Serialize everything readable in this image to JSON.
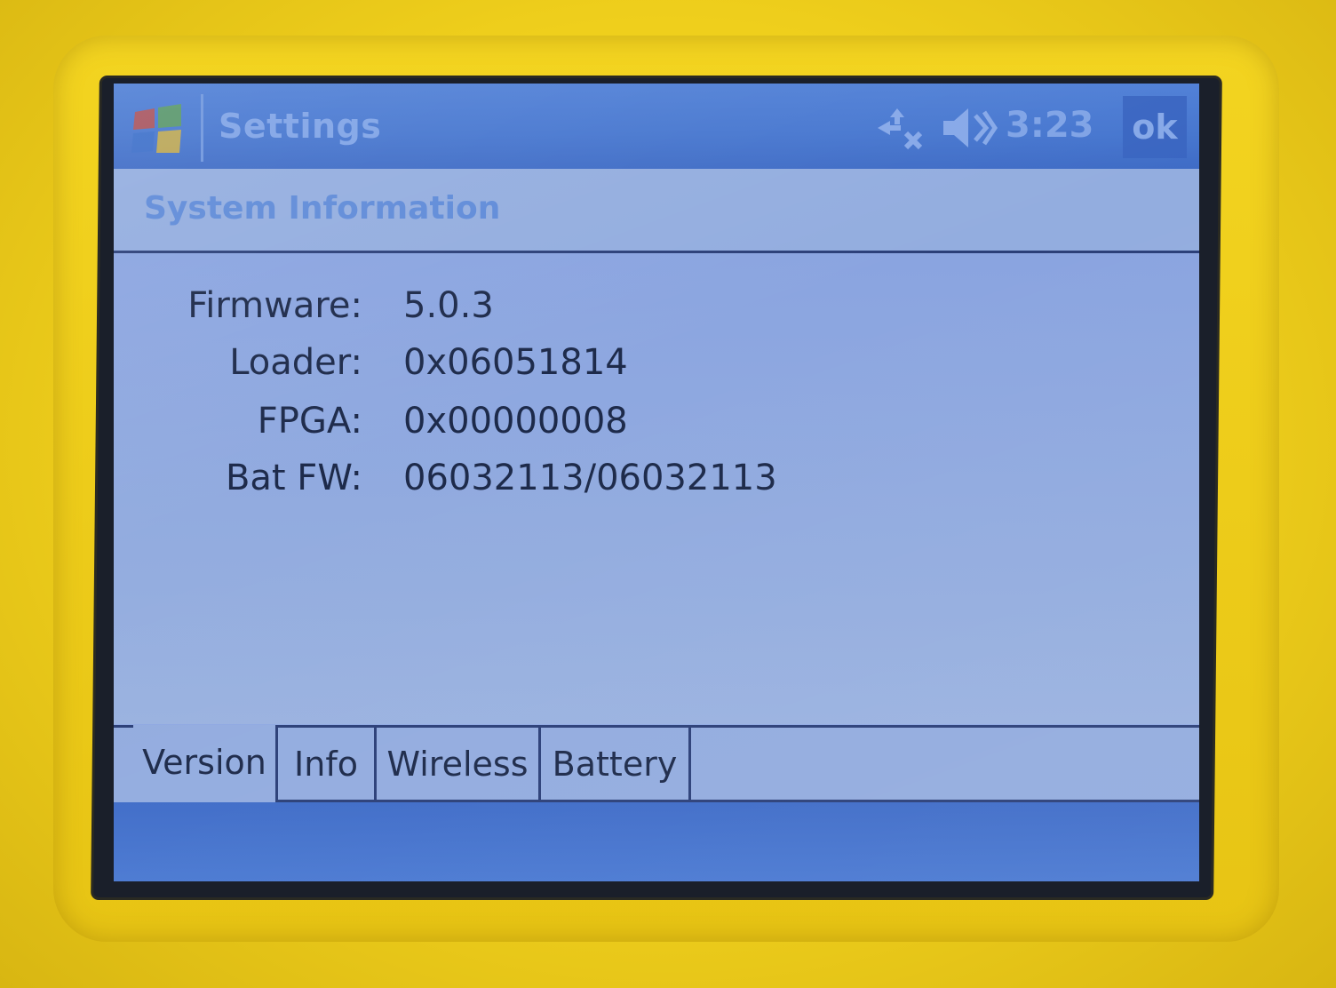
{
  "titlebar": {
    "start_icon": "windows-flag-icon",
    "title": "Settings",
    "connectivity_icon": "connectivity-icon",
    "volume_icon": "speaker-muted-icon",
    "clock": "3:23",
    "ok_label": "ok"
  },
  "header": {
    "title": "System Information"
  },
  "info": {
    "rows": [
      {
        "label": "Firmware:",
        "value": "5.0.3"
      },
      {
        "label": "Loader:",
        "value": "0x06051814"
      },
      {
        "label": "FPGA:",
        "value": "0x00000008"
      },
      {
        "label": "Bat FW:",
        "value": "06032113/06032113"
      }
    ]
  },
  "tabs": [
    {
      "label": "Version",
      "active": true
    },
    {
      "label": "Info",
      "active": false
    },
    {
      "label": "Wireless",
      "active": false
    },
    {
      "label": "Battery",
      "active": false
    }
  ],
  "colors": {
    "device_yellow": "#efcf1c",
    "screen_bg": "#8fa8e2",
    "titlebar_blue": "#4676cf",
    "text_dark": "#1d2a4a"
  }
}
